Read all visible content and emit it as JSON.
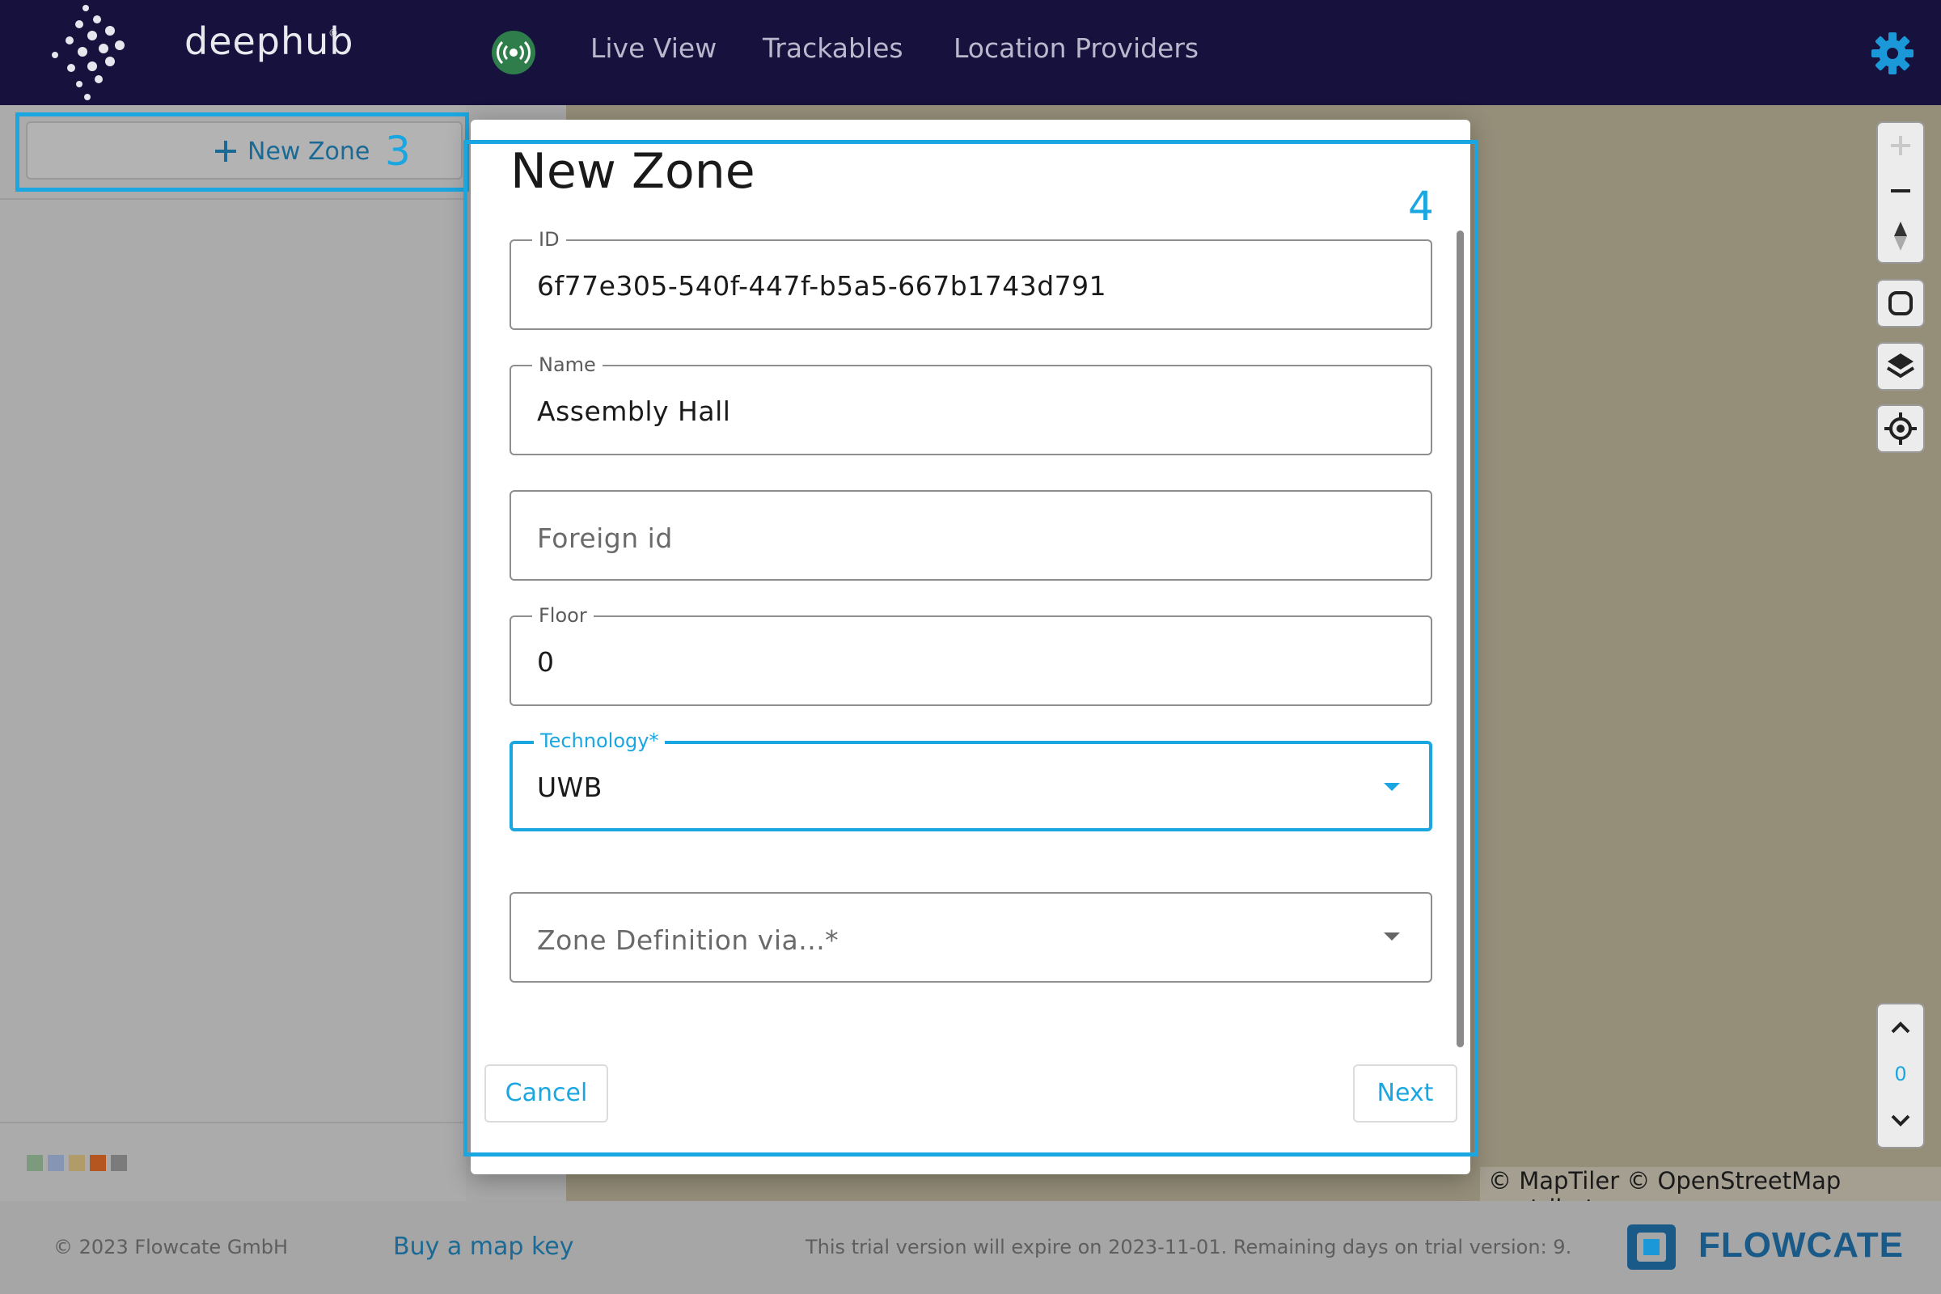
{
  "header": {
    "brand": "deephub",
    "brand_mark": "®",
    "nav": [
      "Live View",
      "Trackables",
      "Location Providers"
    ],
    "icons": {
      "live": "broadcast-icon",
      "settings": "gear-icon"
    }
  },
  "left_panel": {
    "new_zone_label": "New Zone",
    "highlight_number": "3",
    "legend_colors": [
      "#7b9a7e",
      "#8795b5",
      "#b19b68",
      "#b5551f",
      "#7b7b7b"
    ]
  },
  "dialog": {
    "title": "New Zone",
    "highlight_number": "4",
    "fields": {
      "id": {
        "label": "ID",
        "value": "6f77e305-540f-447f-b5a5-667b1743d791"
      },
      "name": {
        "label": "Name",
        "value": "Assembly Hall"
      },
      "foreign_id": {
        "placeholder": "Foreign id"
      },
      "floor": {
        "label": "Floor",
        "value": "0"
      },
      "technology": {
        "label": "Technology*",
        "value": "UWB"
      },
      "zone_definition": {
        "placeholder": "Zone Definition via...*"
      }
    },
    "cancel_label": "Cancel",
    "next_label": "Next"
  },
  "map": {
    "attribution": "© MapTiler © OpenStreetMap contributors",
    "floor_level": "0"
  },
  "footer": {
    "copyright": "© 2023 Flowcate GmbH",
    "buy_key": "Buy a map key",
    "trial_notice": "This trial version will expire on 2023-11-01. Remaining days on trial version: 9.",
    "company_logo_text": "FLOWCATE"
  },
  "colors": {
    "header_bg": "#16123d",
    "accent": "#1aa6e0",
    "link": "#1a6a95"
  }
}
